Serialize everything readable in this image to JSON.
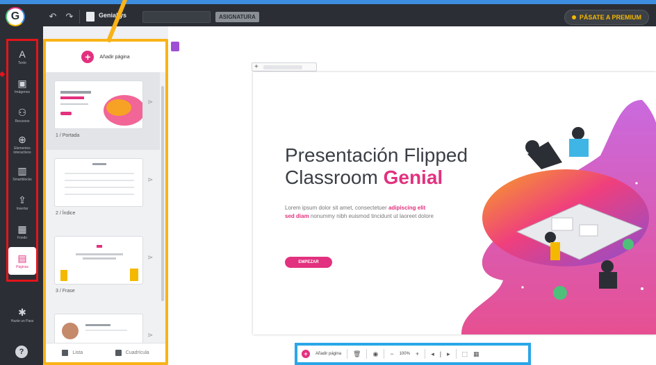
{
  "topbar": {
    "logo_letter": "G",
    "undo_icon": "undo-icon",
    "redo_icon": "redo-icon",
    "doc_title": "Geniallys",
    "tag": "ASIGNATURA",
    "premium_label": "PÁSATE A PREMIUM"
  },
  "rail": {
    "items": [
      {
        "icon": "A",
        "label": "Texto"
      },
      {
        "icon": "▣",
        "label": "Imágenes"
      },
      {
        "icon": "⚇",
        "label": "Recursos"
      },
      {
        "icon": "⊕",
        "label": "Elementos interactivos"
      },
      {
        "icon": "▥",
        "label": "Smartblocks"
      },
      {
        "icon": "⇪",
        "label": "Insertar"
      },
      {
        "icon": "▦",
        "label": "Fondo"
      },
      {
        "icon": "▤",
        "label": "Páginas"
      }
    ],
    "help_icon": "?",
    "bottom_item": {
      "icon": "✱",
      "label": "Hazte un Pass"
    }
  },
  "panel": {
    "add_label": "Añadir página",
    "pages": [
      {
        "label": "1 / Portada"
      },
      {
        "label": "2 / Índice"
      },
      {
        "label": "3 / Frase"
      },
      {
        "label": ""
      }
    ],
    "footer": {
      "list_label": "Lista",
      "grid_label": "Cuadrícula"
    }
  },
  "slide": {
    "title_line1": "Presentación Flipped",
    "title_line2_plain": "Classroom ",
    "title_line2_accent": "Genial",
    "body_plain_1": "Lorem ipsum dolor sit amet, consectetuer ",
    "body_highlight": "adipiscing elit sed diam",
    "body_plain_2": " nonummy nibh euismod tincidunt ut laoreet dolore",
    "button_label": "EMPEZAR"
  },
  "bottom_bar": {
    "add_label": "Añadir página",
    "zoom_minus": "−",
    "zoom": "100%",
    "zoom_plus": "+"
  },
  "colors": {
    "accent": "#e2317e",
    "topbar": "#2b2f35",
    "highlight_red": "#e4141b",
    "highlight_yellow": "#f9b317",
    "highlight_blue": "#2aa6e8"
  }
}
